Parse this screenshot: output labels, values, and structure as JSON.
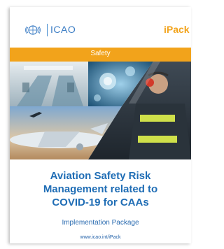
{
  "header": {
    "org_name": "ICAO",
    "product_name": "iPack",
    "logo_icon": "icao-emblem-icon"
  },
  "banner": {
    "label": "Safety",
    "color": "#f2a31b"
  },
  "images": [
    {
      "name": "aircraft-cabin-photo"
    },
    {
      "name": "virus-microscope-photo"
    },
    {
      "name": "airport-worker-photo"
    },
    {
      "name": "airplane-takeoff-photo"
    }
  ],
  "title": {
    "line1": "Aviation Safety Risk",
    "line2": "Management related to",
    "line3": "COVID-19 for CAAs"
  },
  "subtitle": "Implementation Package",
  "url": "www.icao.int/iPack",
  "colors": {
    "title": "#1f6db5",
    "accent": "#f2a31b"
  }
}
